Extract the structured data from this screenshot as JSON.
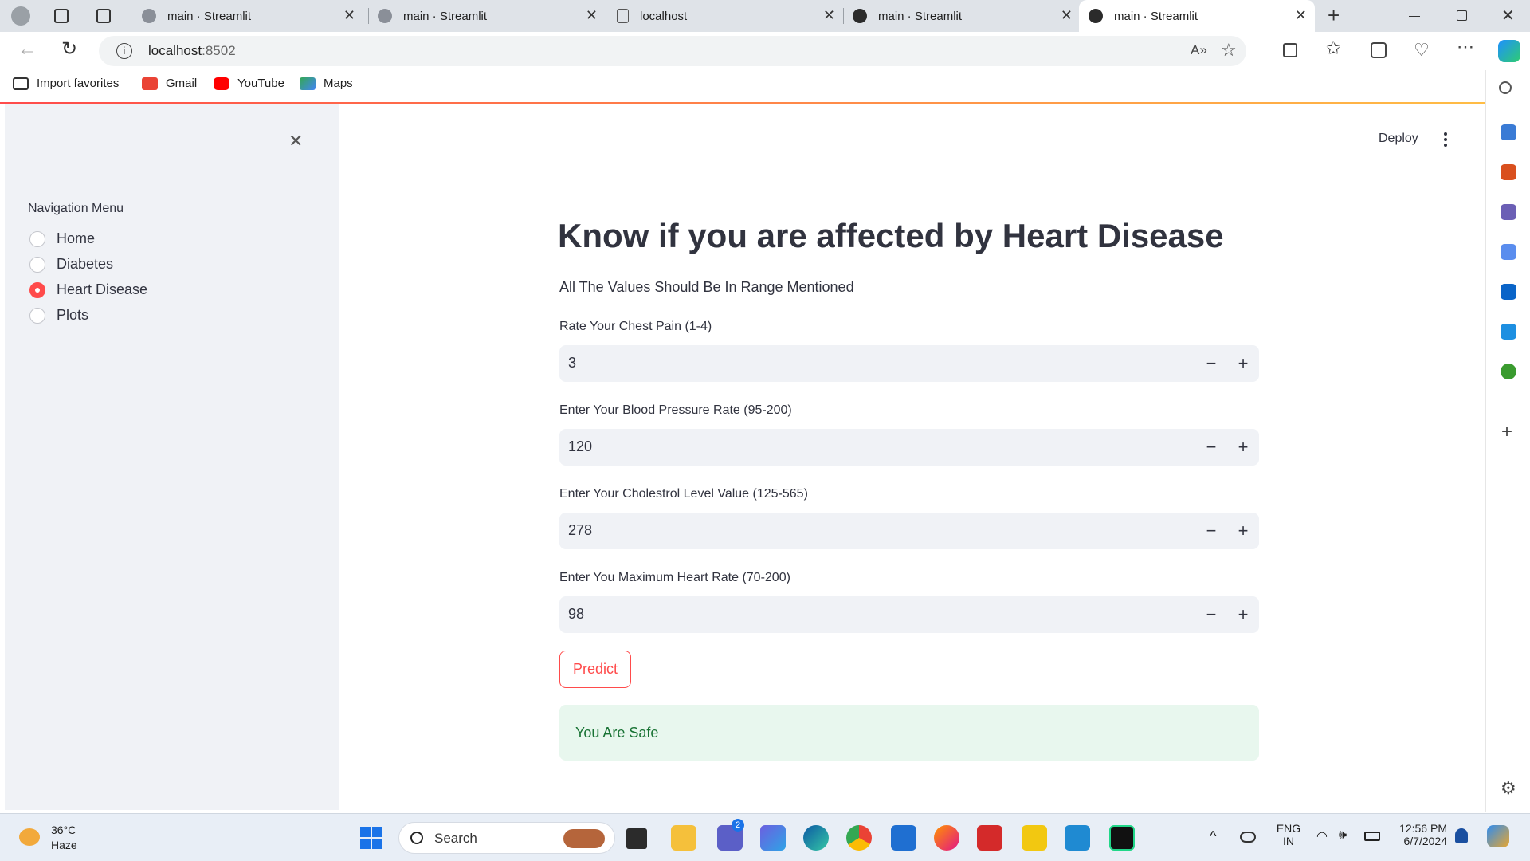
{
  "browser": {
    "tabs": [
      {
        "title": "main · Streamlit"
      },
      {
        "title": "main · Streamlit"
      },
      {
        "title": "localhost"
      },
      {
        "title": "main · Streamlit"
      },
      {
        "title": "main · Streamlit"
      }
    ],
    "active_tab_index": 4,
    "url_host": "localhost",
    "url_port": ":8502",
    "favorites": [
      "Import favorites",
      "Gmail",
      "YouTube",
      "Maps"
    ]
  },
  "app": {
    "deploy_label": "Deploy",
    "sidebar": {
      "menu_title": "Navigation Menu",
      "items": [
        "Home",
        "Diabetes",
        "Heart Disease",
        "Plots"
      ],
      "selected": "Heart Disease"
    },
    "main": {
      "title": "Know if you are affected by Heart Disease",
      "subtitle": "All The Values Should Be In Range Mentioned",
      "fields": [
        {
          "label": "Rate Your Chest Pain (1-4)",
          "value": "3"
        },
        {
          "label": "Enter Your Blood Pressure Rate (95-200)",
          "value": "120"
        },
        {
          "label": "Enter Your Cholestrol Level Value (125-565)",
          "value": "278"
        },
        {
          "label": "Enter You Maximum Heart Rate (70-200)",
          "value": "98"
        }
      ],
      "predict_label": "Predict",
      "result": "You Are Safe"
    }
  },
  "taskbar": {
    "weather_temp": "36°C",
    "weather_desc": "Haze",
    "search_placeholder": "Search",
    "teams_badge": "2",
    "lang": "ENG",
    "region": "IN",
    "time": "12:56 PM",
    "date": "6/7/2024"
  },
  "colors": {
    "accent": "#ff4b4b",
    "sidebar_bg": "#f0f2f6",
    "success_bg": "#e8f7ee",
    "success_text": "#177233"
  }
}
